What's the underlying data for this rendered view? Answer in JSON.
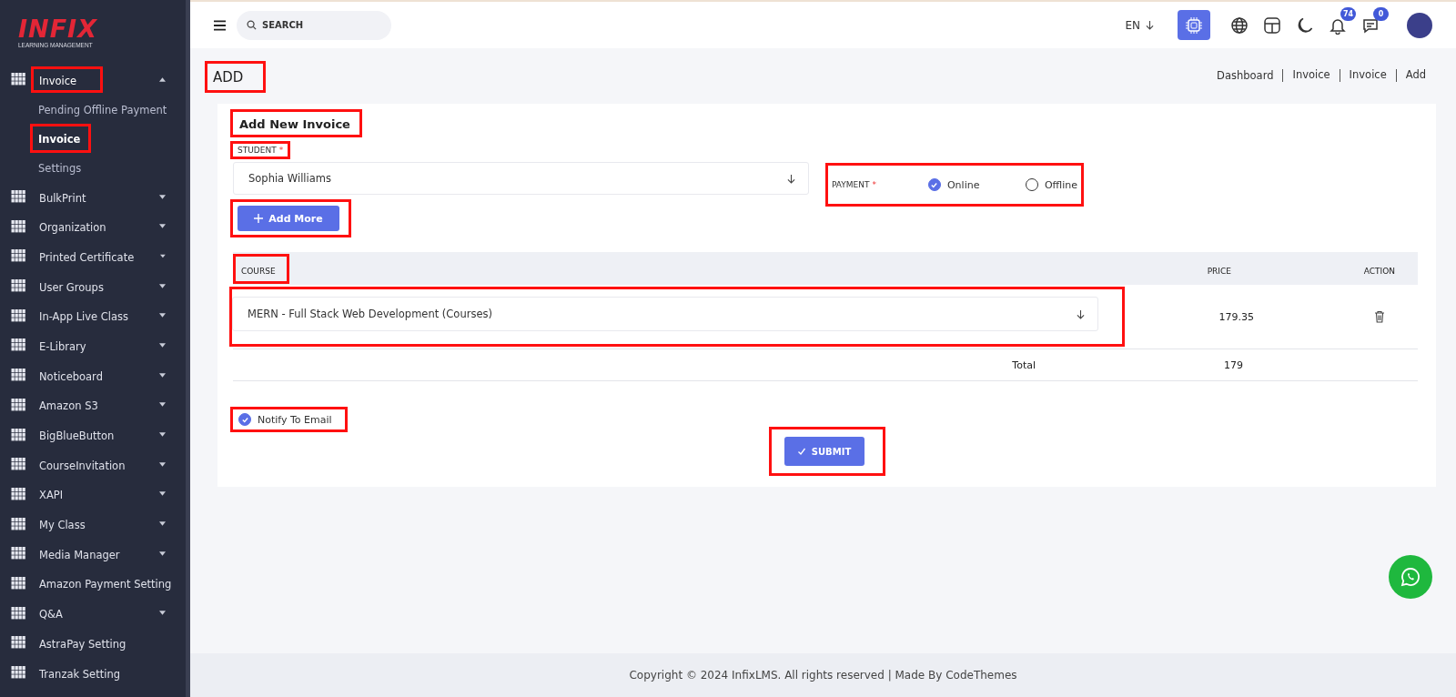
{
  "logo": {
    "name": "INFIX",
    "tagline": "LEARNING MANAGEMENT"
  },
  "sidebar": {
    "items": [
      {
        "label": "Invoice",
        "kind": "group",
        "expanded": true,
        "highlighted": true,
        "children": [
          {
            "label": "Pending Offline Payment",
            "selected": false,
            "highlighted": false
          },
          {
            "label": "Invoice",
            "selected": true,
            "highlighted": true
          },
          {
            "label": "Settings",
            "selected": false,
            "highlighted": false
          }
        ]
      },
      {
        "label": "BulkPrint",
        "kind": "group",
        "expanded": false,
        "highlighted": false
      },
      {
        "label": "Organization",
        "kind": "group",
        "expanded": false,
        "highlighted": false
      },
      {
        "label": "Printed Certificate",
        "kind": "group",
        "expanded": false,
        "highlighted": false
      },
      {
        "label": "User Groups",
        "kind": "group",
        "expanded": false,
        "highlighted": false
      },
      {
        "label": "In-App Live Class",
        "kind": "group",
        "expanded": false,
        "highlighted": false
      },
      {
        "label": "E-Library",
        "kind": "group",
        "expanded": false,
        "highlighted": false
      },
      {
        "label": "Noticeboard",
        "kind": "group",
        "expanded": false,
        "highlighted": false
      },
      {
        "label": "Amazon S3",
        "kind": "group",
        "expanded": false,
        "highlighted": false
      },
      {
        "label": "BigBlueButton",
        "kind": "group",
        "expanded": false,
        "highlighted": false
      },
      {
        "label": "CourseInvitation",
        "kind": "group",
        "expanded": false,
        "highlighted": false
      },
      {
        "label": "XAPI",
        "kind": "group",
        "expanded": false,
        "highlighted": false
      },
      {
        "label": "My Class",
        "kind": "group",
        "expanded": false,
        "highlighted": false
      },
      {
        "label": "Media Manager",
        "kind": "group",
        "expanded": false,
        "highlighted": false
      },
      {
        "label": "Amazon Payment Setting",
        "kind": "link",
        "highlighted": false
      },
      {
        "label": "Q&A",
        "kind": "group",
        "expanded": false,
        "highlighted": false
      },
      {
        "label": "AstraPay Setting",
        "kind": "link",
        "highlighted": false
      },
      {
        "label": "Tranzak Setting",
        "kind": "link",
        "highlighted": false
      }
    ]
  },
  "header": {
    "search_placeholder": "SEARCH",
    "language": "EN",
    "notifications": "74",
    "messages": "0"
  },
  "page": {
    "title": "ADD",
    "title_highlighted": true,
    "breadcrumbs": [
      "Dashboard",
      "Invoice",
      "Invoice",
      "Add"
    ]
  },
  "form": {
    "title": "Add New Invoice",
    "title_highlighted": true,
    "student": {
      "label": "STUDENT",
      "required_mark": "*",
      "value": "Sophia Williams",
      "highlighted": true
    },
    "payment": {
      "label": "PAYMENT",
      "required_mark": "*",
      "highlighted": true,
      "options": [
        {
          "label": "Online",
          "selected": true
        },
        {
          "label": "Offline",
          "selected": false
        }
      ]
    },
    "add_more": {
      "label": "Add More",
      "highlighted": true
    },
    "table": {
      "columns": [
        {
          "label": "COURSE",
          "highlighted": true
        },
        {
          "label": "PRICE",
          "highlighted": false
        },
        {
          "label": "ACTION",
          "highlighted": false
        }
      ],
      "rows": [
        {
          "course": "MERN - Full Stack Web Development (Courses)",
          "price": "179.35",
          "highlighted": true
        }
      ],
      "total_label": "Total",
      "total": "179"
    },
    "notify": {
      "label": "Notify To Email",
      "checked": true,
      "highlighted": true
    },
    "submit": {
      "label": "SUBMIT",
      "highlighted": true
    }
  },
  "footer": "Copyright © 2024 InfixLMS. All rights reserved | Made By CodeThemes"
}
